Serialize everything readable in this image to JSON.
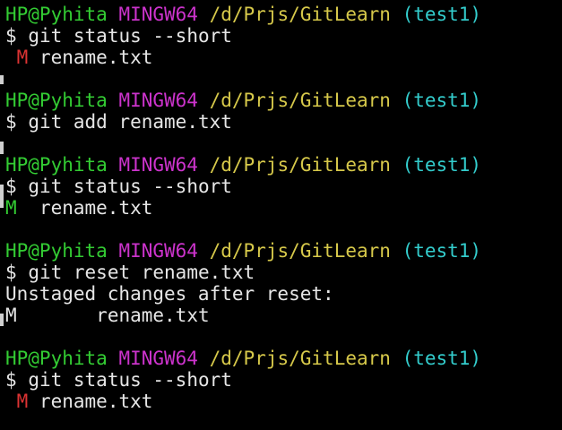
{
  "prompt": {
    "user_host": "HP@Pyhita",
    "system": "MINGW64",
    "path": "/d/Prjs/GitLearn",
    "branch": "(test1)",
    "symbol": "$"
  },
  "blocks": [
    {
      "command": "git status --short",
      "output": [
        {
          "type": "status",
          "code": "M",
          "color": "red",
          "indent": " ",
          "gap": " ",
          "file": "rename.txt"
        }
      ]
    },
    {
      "command": "git add rename.txt",
      "output": []
    },
    {
      "command": "git status --short",
      "output": [
        {
          "type": "status",
          "code": "M",
          "color": "green",
          "indent": "",
          "gap": "  ",
          "file": "rename.txt"
        }
      ]
    },
    {
      "command": "git reset rename.txt",
      "output": [
        {
          "type": "text",
          "text": "Unstaged changes after reset:"
        },
        {
          "type": "status",
          "code": "M",
          "color": "white",
          "indent": "",
          "gap": "       ",
          "file": "rename.txt"
        }
      ]
    },
    {
      "command": "git status --short",
      "output": [
        {
          "type": "status",
          "code": "M",
          "color": "red",
          "indent": " ",
          "gap": " ",
          "file": "rename.txt"
        }
      ]
    }
  ],
  "colors": {
    "background": "#000000",
    "user_host": "#33cc33",
    "system": "#cc33cc",
    "path": "#d6c84a",
    "branch": "#33cccc",
    "modified_unstaged": "#dd3333",
    "modified_staged": "#33cc33",
    "text": "#e6e6e6"
  }
}
